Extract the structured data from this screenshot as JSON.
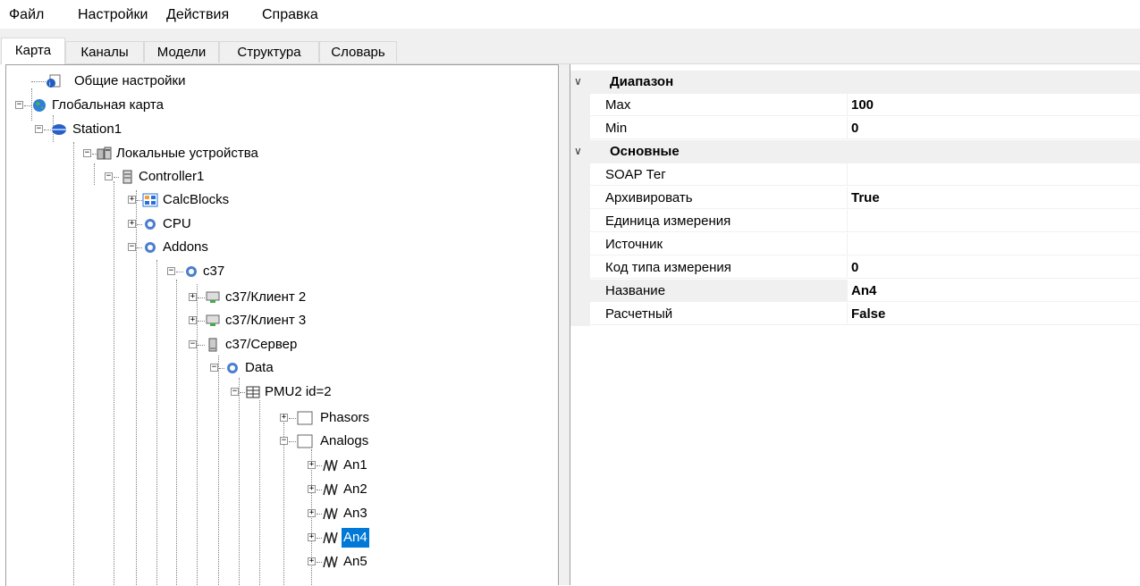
{
  "menu": {
    "file": "Файл",
    "settings": "Настройки",
    "actions": "Действия",
    "help": "Справка"
  },
  "tabs": [
    {
      "label": "Карта",
      "active": true
    },
    {
      "label": "Каналы",
      "active": false
    },
    {
      "label": "Модели",
      "active": false
    },
    {
      "label": "Структура",
      "active": false
    },
    {
      "label": "Словарь",
      "active": false
    }
  ],
  "tree": {
    "general_settings": "Общие настройки",
    "global_map": "Глобальная карта",
    "station": "Station1",
    "local_devices": "Локальные устройства",
    "controller": "Controller1",
    "calcblocks": "CalcBlocks",
    "cpu": "CPU",
    "addons": "Addons",
    "c37": "c37",
    "client2": "c37/Клиент 2",
    "client3": "c37/Клиент 3",
    "server": "c37/Сервер",
    "data": "Data",
    "pmu": "PMU2 id=2",
    "phasors": "Phasors",
    "analogs": "Analogs",
    "an1": "An1",
    "an2": "An2",
    "an3": "An3",
    "an4": "An4",
    "an5": "An5",
    "selected": "An4"
  },
  "properties": {
    "range_category": "Диапазон",
    "max_label": "Max",
    "max_value": "100",
    "min_label": "Min",
    "min_value": "0",
    "main_category": "Основные",
    "soap_label": "SOAP Тег",
    "soap_value": "",
    "archive_label": "Архивировать",
    "archive_value": "True",
    "unit_label": "Единица измерения",
    "unit_value": "",
    "source_label": "Источник",
    "source_value": "",
    "measure_code_label": "Код типа измерения",
    "measure_code_value": "0",
    "name_label": "Название",
    "name_value": "An4",
    "calc_label": "Расчетный",
    "calc_value": "False"
  },
  "colors": {
    "selection": "#0078d7",
    "panel_bg": "#f0f0f0"
  }
}
